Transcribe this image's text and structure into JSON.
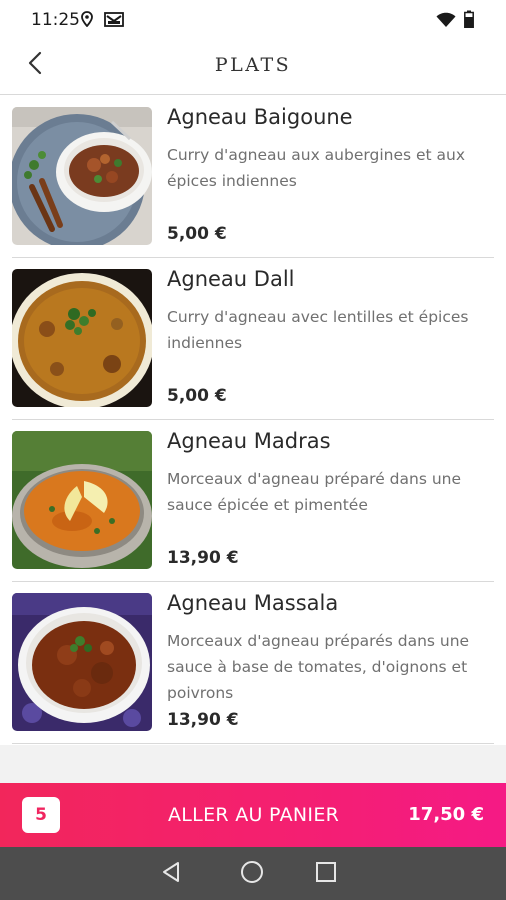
{
  "status_bar": {
    "time": "11:25",
    "icons": [
      "location-icon",
      "mail-icon",
      "wifi-icon",
      "battery-icon"
    ]
  },
  "header": {
    "title": "PLATS",
    "back_icon": "chevron-left-icon"
  },
  "dishes": [
    {
      "name": "Agneau Baigoune",
      "description": "Curry d'agneau aux aubergines et aux épices indiennes",
      "price": "5,00 €"
    },
    {
      "name": "Agneau Dall",
      "description": "Curry d'agneau avec lentilles et épices indiennes",
      "price": "5,00 €"
    },
    {
      "name": "Agneau Madras",
      "description": "Morceaux d'agneau préparé dans une sauce épicée et pimentée",
      "price": "13,90 €"
    },
    {
      "name": "Agneau Massala",
      "description": "Morceaux d'agneau préparés dans une sauce à base de tomates, d'oignons et poivrons",
      "price": "13,90 €"
    }
  ],
  "cart": {
    "count": "5",
    "label": "ALLER AU PANIER",
    "total": "17,50 €"
  },
  "nav": {
    "icons": [
      "back-triangle-icon",
      "home-circle-icon",
      "recents-square-icon"
    ]
  },
  "colors": {
    "accent": "#f2265b",
    "accent_end": "#f51a85",
    "nav_bg": "#4d4d4d",
    "divider": "#d9d9d9"
  }
}
